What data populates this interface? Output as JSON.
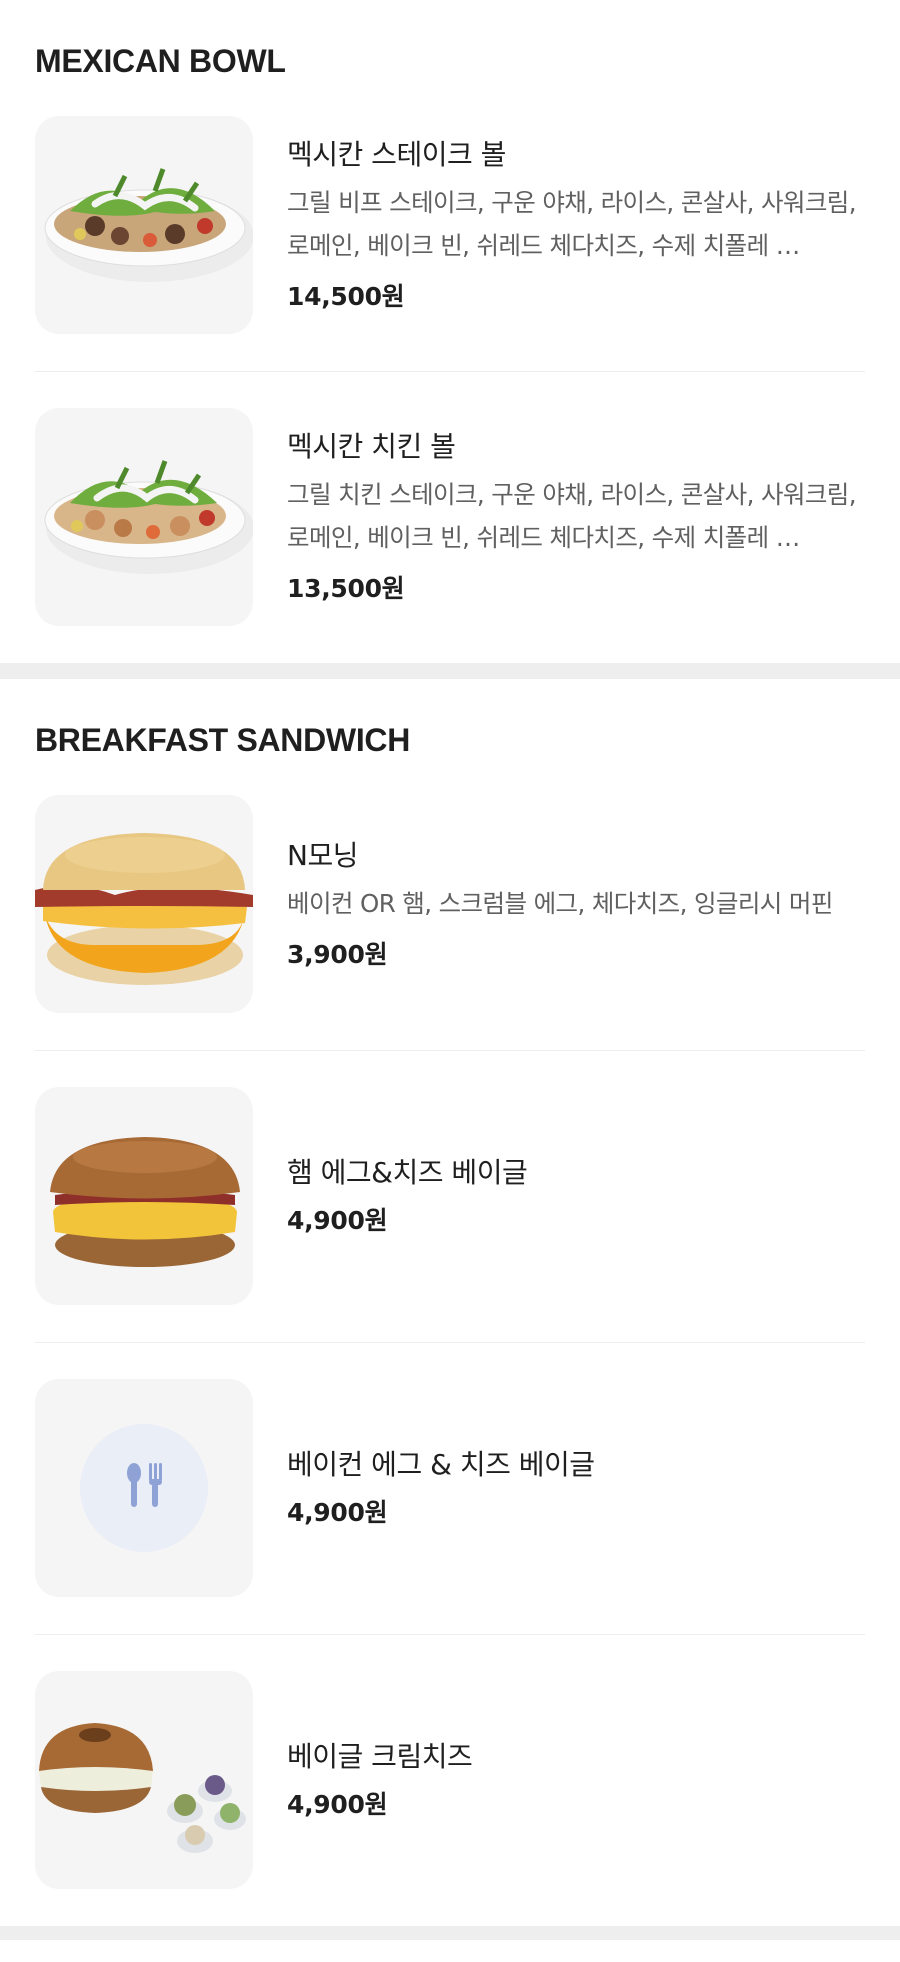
{
  "sections": [
    {
      "title": "MEXICAN BOWL",
      "items": [
        {
          "name": "멕시칸 스테이크 볼",
          "desc": "그릴 비프 스테이크, 구운 야채, 라이스, 콘살사, 사워크림, 로메인, 베이크 빈, 쉬레드 체다치즈, 수제 치폴레 …",
          "price": "14,500원",
          "image": "steak-bowl"
        },
        {
          "name": "멕시칸 치킨 볼",
          "desc": "그릴 치킨 스테이크, 구운 야채, 라이스, 콘살사, 사워크림, 로메인, 베이크 빈, 쉬레드 체다치즈, 수제 치폴레 …",
          "price": "13,500원",
          "image": "chicken-bowl"
        }
      ]
    },
    {
      "title": "BREAKFAST SANDWICH",
      "items": [
        {
          "name": "N모닝",
          "desc": "베이컨 OR 햄, 스크럼블 에그, 체다치즈, 잉글리시 머핀",
          "price": "3,900원",
          "image": "english-muffin"
        },
        {
          "name": "햄 에그&치즈 베이글",
          "desc": "",
          "price": "4,900원",
          "image": "ham-egg-bagel"
        },
        {
          "name": "베이컨 에그 & 치즈 베이글",
          "desc": "",
          "price": "4,900원",
          "image": "placeholder-utensils-icon"
        },
        {
          "name": "베이글 크림치즈",
          "desc": "",
          "price": "4,900원",
          "image": "bagel-cream-cheese"
        }
      ]
    }
  ],
  "colors": {
    "text": "#1f1f1f",
    "desc": "#606060",
    "band": "#eeeeee",
    "thumb_bg": "#f5f5f5",
    "placeholder_circle": "#e9eef7",
    "placeholder_icon": "#8fa2d6"
  }
}
